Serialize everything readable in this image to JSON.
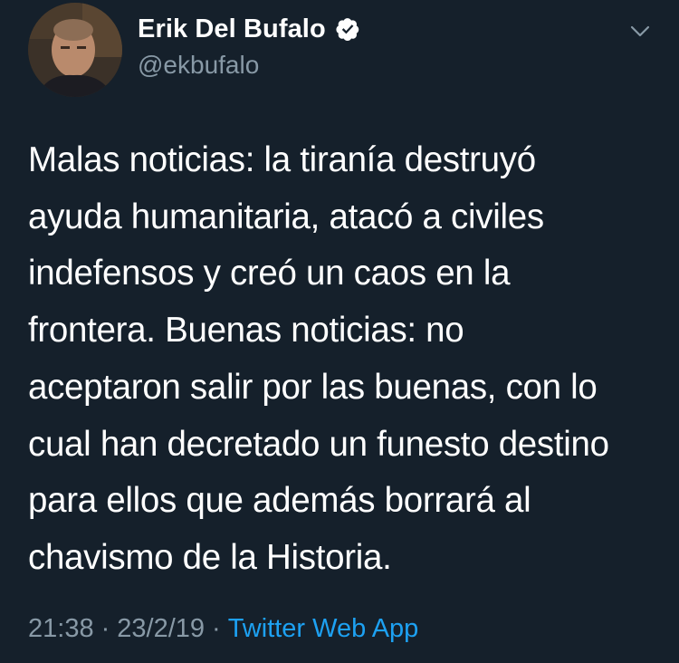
{
  "author": {
    "display_name": "Erik Del Bufalo",
    "handle": "@ekbufalo",
    "verified": true
  },
  "tweet": {
    "text": "Malas noticias: la tiranía destruyó ayuda humanitaria, atacó a civiles indefensos y creó un caos en la frontera. Buenas noticias: no aceptaron salir por las buenas, con lo cual han decretado un funesto destino para ellos que además borrará al chavismo de la Historia.",
    "lines": [
      "Malas noticias: la tiranía destruyó",
      "ayuda humanitaria, atacó a civiles",
      "indefensos y creó un caos en la",
      "frontera. Buenas noticias: no",
      "aceptaron salir por las buenas, con lo",
      "cual han decretado un funesto destino",
      "para ellos que además borrará al",
      "chavismo de la Historia."
    ],
    "time": "21:38",
    "separator": "·",
    "date": "23/2/19",
    "source": "Twitter Web App"
  },
  "colors": {
    "background": "#15202b",
    "text_primary": "#ffffff",
    "text_secondary": "#8899a6",
    "accent": "#1da1f2"
  },
  "icons": {
    "verified": "verified-badge-icon",
    "menu": "chevron-down-icon"
  }
}
